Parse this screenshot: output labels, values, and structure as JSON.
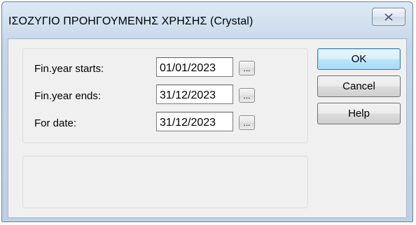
{
  "window": {
    "title": "ΙΣΟΖΥΓΙΟ ΠΡΟΗΓΟΥΜΕΝΗΣ ΧΡΗΣΗΣ (Crystal)",
    "close_icon": "close-x-icon"
  },
  "form": {
    "rows": [
      {
        "label": "Fin.year starts:",
        "value": "01/01/2023",
        "browse_label": "..."
      },
      {
        "label": "Fin.year ends:",
        "value": "31/12/2023",
        "browse_label": "..."
      },
      {
        "label": "For date:",
        "value": "31/12/2023",
        "browse_label": "..."
      }
    ]
  },
  "buttons": {
    "ok": "OK",
    "cancel": "Cancel",
    "help": "Help"
  },
  "colors": {
    "title_bar": "#cfdeed",
    "client_bg": "#f0f0f0",
    "default_button_border": "#3c7fb1"
  }
}
